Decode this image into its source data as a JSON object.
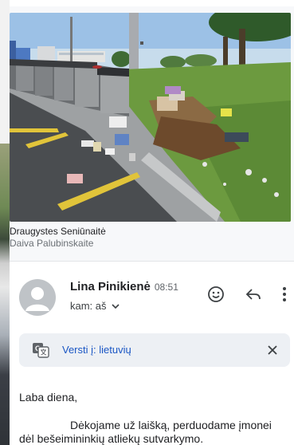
{
  "image": {
    "alt_name": "roadside-waste-containers-photo"
  },
  "caption": {
    "title": "Draugystes Seniūnaitė",
    "subtitle": "Daiva Palubinskaite"
  },
  "email": {
    "sender_name": "Lina Pinikienė",
    "time": "08:51",
    "recipient": "kam: aš",
    "translate_label": "Versti į: lietuvių",
    "greeting": "Laba diena,",
    "body_line1": "Dėkojame už laišką, perduodame įmonei",
    "body_line2": "dėl bešeimininkių atliekų sutvarkymo."
  },
  "icons": {
    "emoji": "emoji-smile-icon",
    "reply": "reply-icon",
    "more": "more-vert-icon",
    "translate": "translate-icon",
    "close": "close-icon",
    "chevron": "chevron-down-icon"
  },
  "colors": {
    "link_blue": "#1a56c4",
    "translate_bg": "#edf0f4",
    "avatar_bg": "#bfc3c7"
  }
}
